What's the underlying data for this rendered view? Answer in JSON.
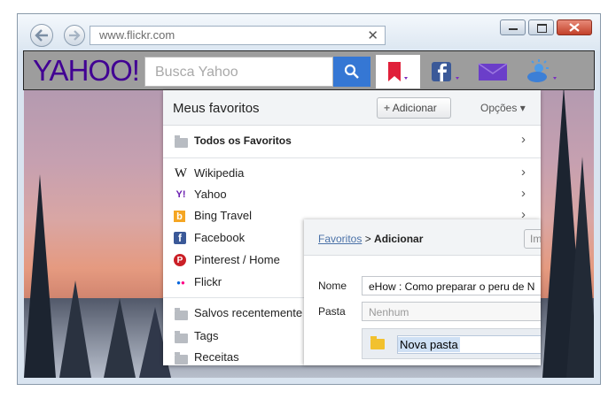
{
  "browser": {
    "url": "www.flickr.com",
    "clear_glyph": "✕"
  },
  "yahoo_toolbar": {
    "logo": "YAHOO!",
    "search_placeholder": "Busca Yahoo",
    "icons": [
      "search-icon",
      "bookmark-icon",
      "facebook-icon",
      "mail-icon",
      "weather-icon"
    ],
    "colors": {
      "logo": "#410093",
      "search_button": "#3577d4",
      "bookmark": "#e0203a"
    }
  },
  "favorites": {
    "title": "Meus favoritos",
    "add_button": "Adicionar",
    "add_glyph": "+",
    "options": "Opções",
    "options_glyph": "▾",
    "all_favorites": "Todos os Favoritos",
    "items": [
      {
        "label": "Wikipedia",
        "icon": "wikipedia-icon",
        "glyph": "W"
      },
      {
        "label": "Yahoo",
        "icon": "yahoo-icon",
        "glyph": "Y!"
      },
      {
        "label": "Bing Travel",
        "icon": "bing-icon",
        "glyph": "b"
      },
      {
        "label": "Facebook",
        "icon": "facebook-icon",
        "glyph": "f"
      },
      {
        "label": "Pinterest / Home",
        "icon": "pinterest-icon",
        "glyph": "P"
      },
      {
        "label": "Flickr",
        "icon": "flickr-icon",
        "glyph": "●●"
      }
    ],
    "folders": [
      "Salvos recentemente",
      "Tags",
      "Receitas"
    ]
  },
  "add_dialog": {
    "breadcrumb_link": "Favoritos",
    "breadcrumb_sep": " > ",
    "breadcrumb_current": "Adicionar",
    "import_button": "Im",
    "name_label": "Nome",
    "name_value": "eHow : Como preparar o peru de N",
    "folder_label": "Pasta",
    "folder_placeholder": "Nenhum",
    "new_folder": "Nova pasta"
  }
}
